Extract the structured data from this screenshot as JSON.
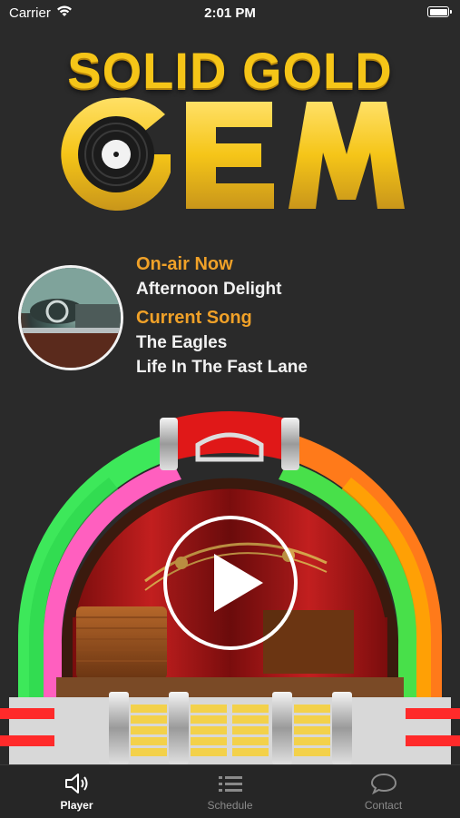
{
  "status_bar": {
    "carrier": "Carrier",
    "time": "2:01 PM"
  },
  "logo": {
    "line1": "SOLID GOLD",
    "line2": "GEM"
  },
  "now_playing": {
    "on_air_label": "On-air Now",
    "show_name": "Afternoon Delight",
    "current_song_label": "Current Song",
    "artist": "The Eagles",
    "song_title": "Life In The Fast Lane"
  },
  "tabs": [
    {
      "label": "Player",
      "icon": "speaker-icon",
      "active": true
    },
    {
      "label": "Schedule",
      "icon": "list-icon",
      "active": false
    },
    {
      "label": "Contact",
      "icon": "chat-bubble-icon",
      "active": false
    }
  ],
  "colors": {
    "accent_orange": "#f0a128",
    "gold": "#f5c518",
    "background": "#2a2a2a"
  }
}
